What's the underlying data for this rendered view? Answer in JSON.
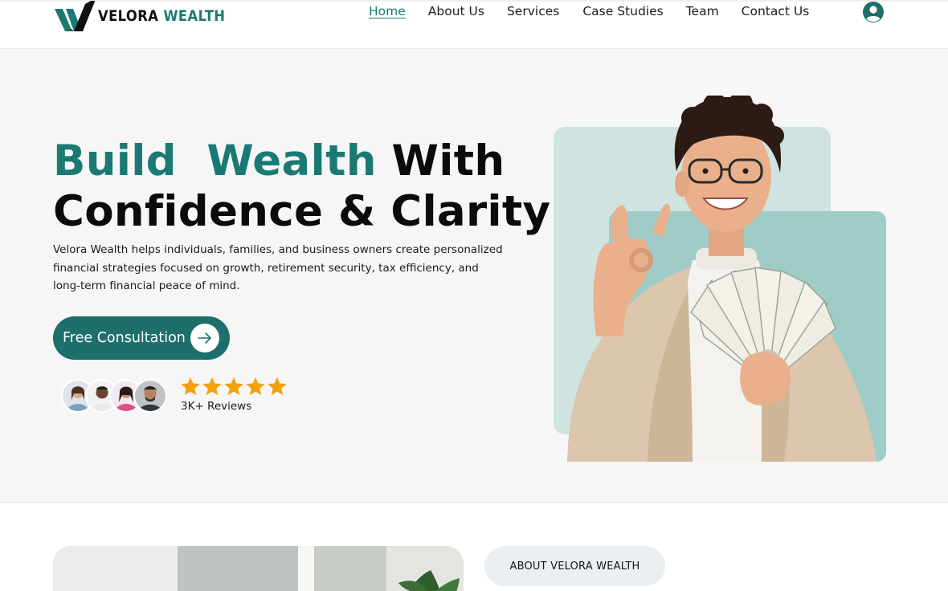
{
  "header": {
    "brand_primary": "VELORA",
    "brand_secondary": "WEALTH",
    "nav": [
      {
        "label": "Home",
        "active": true
      },
      {
        "label": "About Us",
        "active": false
      },
      {
        "label": "Services",
        "active": false
      },
      {
        "label": "Case Studies",
        "active": false
      },
      {
        "label": "Team",
        "active": false
      },
      {
        "label": "Contact Us",
        "active": false
      }
    ],
    "account_icon": "user-circle-icon"
  },
  "hero": {
    "headline_word1": "Build",
    "headline_word2": "Wealth",
    "headline_word3": "With",
    "headline_line2": "Confidence & Clarity",
    "description": "Velora Wealth helps individuals, families, and business owners create personalized financial strategies focused on growth, retirement security, tax efficiency, and long-term financial peace of mind.",
    "cta_label": "Free Consultation",
    "cta_icon": "arrow-right-icon",
    "rating_stars": 5,
    "reviews_label": "3K+ Reviews"
  },
  "about": {
    "badge_label": "ABOUT VELORA WEALTH"
  },
  "colors": {
    "accent": "#1a7a73",
    "cta_background": "#1d6f6b",
    "hero_background": "#f6f6f6",
    "star": "#f2a20c",
    "hero_panel": "#bfdcd8"
  }
}
